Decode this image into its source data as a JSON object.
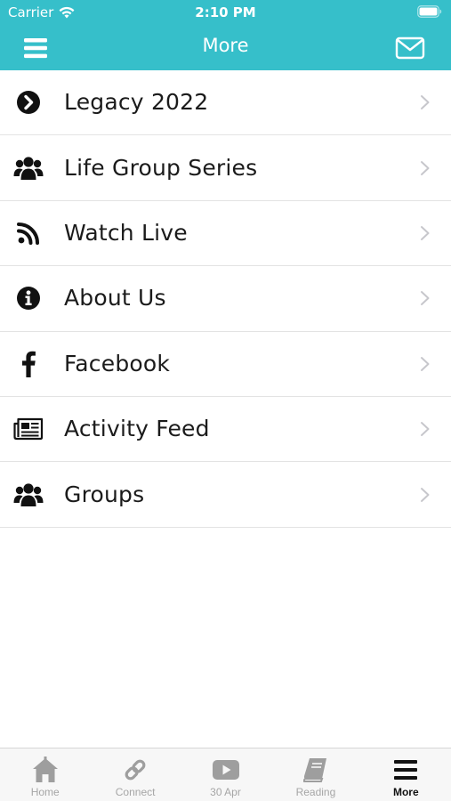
{
  "status_bar": {
    "carrier": "Carrier",
    "time": "2:10 PM"
  },
  "nav": {
    "title": "More"
  },
  "menu_items": [
    {
      "label": "Legacy 2022",
      "icon": "chevron-circle-right-icon"
    },
    {
      "label": "Life Group Series",
      "icon": "users-icon"
    },
    {
      "label": "Watch Live",
      "icon": "rss-icon"
    },
    {
      "label": "About Us",
      "icon": "info-circle-icon"
    },
    {
      "label": "Facebook",
      "icon": "facebook-icon"
    },
    {
      "label": "Activity Feed",
      "icon": "newspaper-icon"
    },
    {
      "label": "Groups",
      "icon": "users-icon"
    }
  ],
  "tabbar": {
    "tabs": [
      {
        "label": "Home",
        "icon": "home-icon"
      },
      {
        "label": "Connect",
        "icon": "link-icon"
      },
      {
        "label": "30 Apr",
        "icon": "play-icon"
      },
      {
        "label": "Reading",
        "icon": "book-icon"
      },
      {
        "label": "More",
        "icon": "menu-icon"
      }
    ],
    "active": "More"
  },
  "colors": {
    "header": "#36bfca",
    "tab_inactive": "#a6a6a6",
    "tab_active": "#111111"
  }
}
